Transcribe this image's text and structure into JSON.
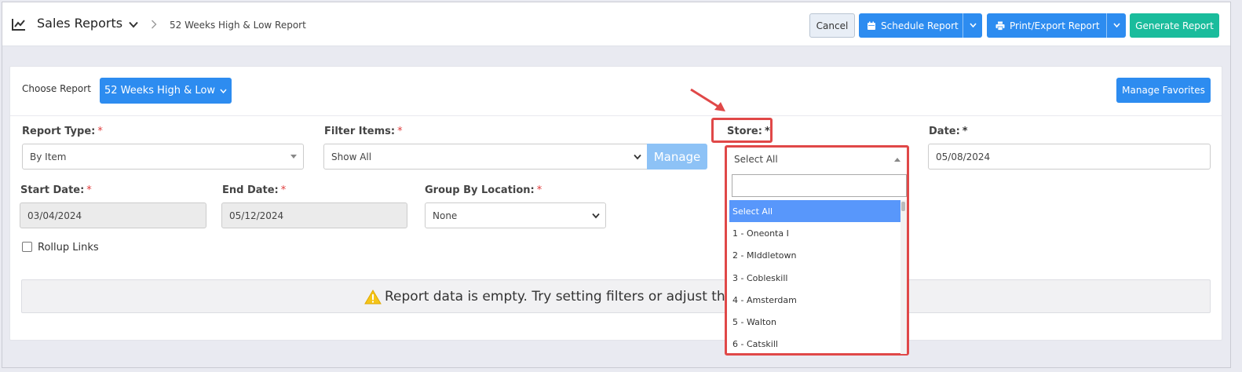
{
  "header": {
    "app_title": "Sales Reports",
    "breadcrumb_current": "52 Weeks High & Low Report",
    "cancel_label": "Cancel",
    "schedule_label": "Schedule Report",
    "print_label": "Print/Export Report",
    "generate_label": "Generate Report"
  },
  "controls": {
    "choose_report_label": "Choose Report",
    "choose_report_value": "52 Weeks High & Low",
    "manage_favorites_label": "Manage Favorites"
  },
  "fields": {
    "report_type": {
      "label": "Report Type:",
      "required": "*",
      "value": "By Item"
    },
    "filter_items": {
      "label": "Filter Items:",
      "required": "*",
      "value": "Show All",
      "manage_label": "Manage"
    },
    "store": {
      "label": "Store:",
      "required": "*",
      "value": "Select All",
      "search_value": "",
      "options": [
        "Select All",
        "1 - Oneonta I",
        "2 - MIddletown",
        "3 - Cobleskill",
        "4 - Amsterdam",
        "5 - Walton",
        "6 - Catskill"
      ],
      "selected_option": "Select All"
    },
    "date": {
      "label": "Date:",
      "required": "*",
      "value": "05/08/2024"
    },
    "start_date": {
      "label": "Start Date:",
      "required": "*",
      "value": "03/04/2024"
    },
    "end_date": {
      "label": "End Date:",
      "required": "*",
      "value": "05/12/2024"
    },
    "group_by_location": {
      "label": "Group By Location:",
      "required": "*",
      "value": "None"
    },
    "rollup_links": {
      "label": "Rollup Links",
      "checked": false
    }
  },
  "empty_state": {
    "message": "Report data is empty. Try setting filters or adjust the"
  },
  "colors": {
    "primary": "#2d8cf0",
    "success": "#1abc9c",
    "required": "#e03c3c",
    "highlight": "#e04848",
    "selected_option": "#5897fb",
    "warning": "#f5c518"
  },
  "icons": [
    "line-chart-icon",
    "chevron-down-icon",
    "chevron-right-icon",
    "calendar-icon",
    "printer-icon",
    "caret-down-icon",
    "warning-icon"
  ]
}
